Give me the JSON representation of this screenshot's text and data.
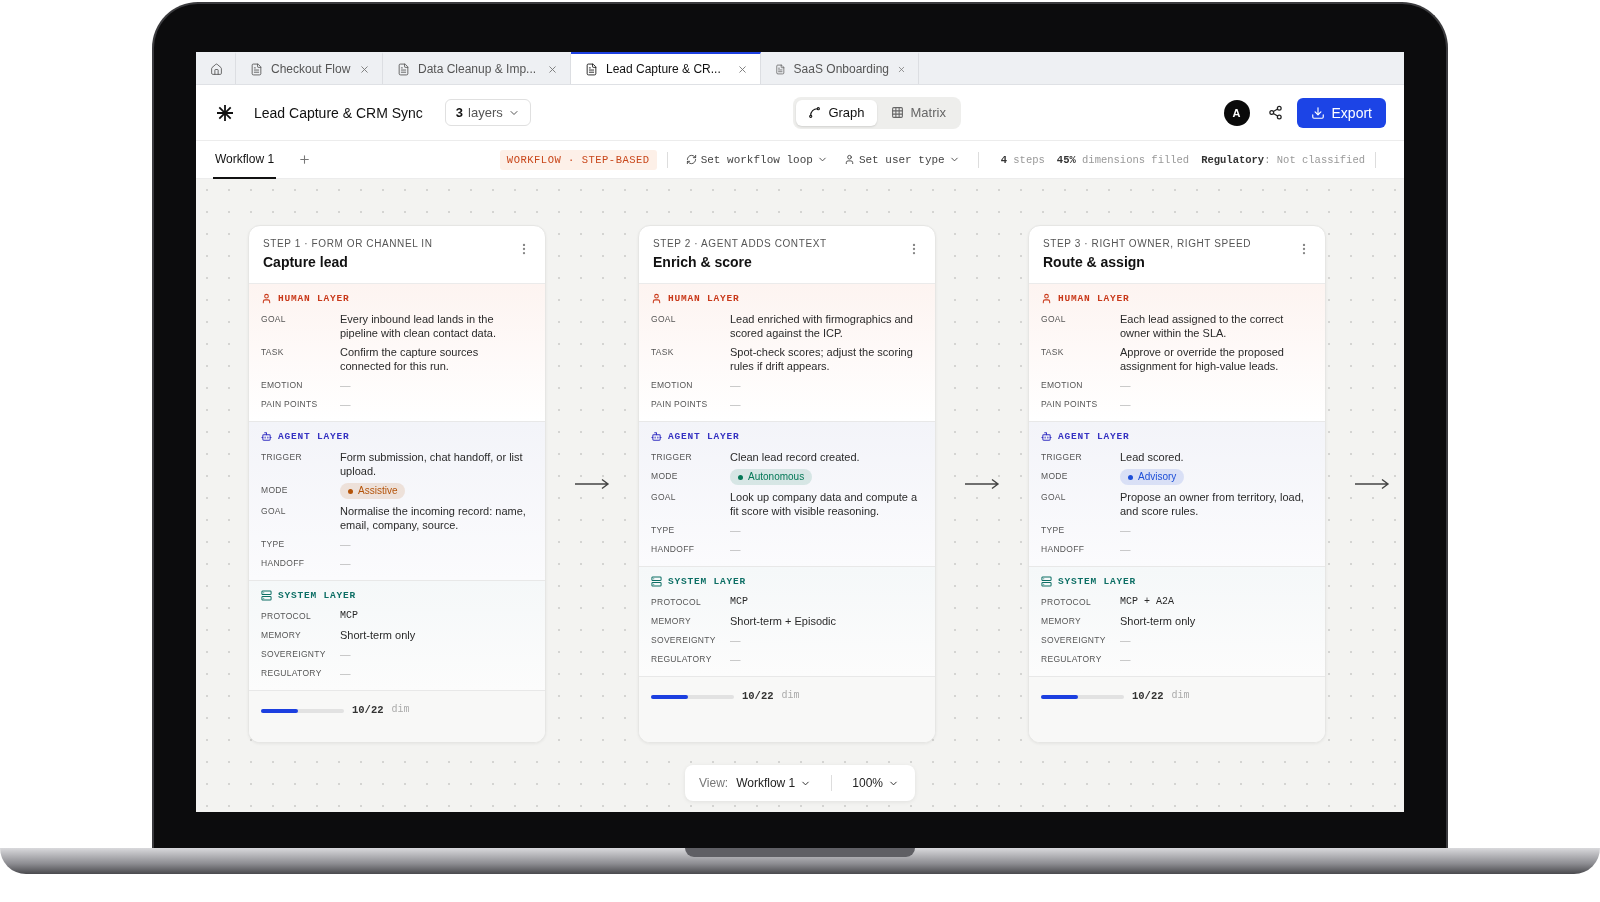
{
  "tabs": [
    {
      "kind": "home",
      "selected": false
    },
    {
      "kind": "document",
      "label": "Checkout Flow",
      "selected": false
    },
    {
      "kind": "document",
      "label": "Data Cleanup & Imp...",
      "selected": false
    },
    {
      "kind": "document",
      "label": "Lead Capture & CR...",
      "selected": true
    },
    {
      "kind": "document",
      "label": "SaaS Onboarding",
      "selected": false
    }
  ],
  "header": {
    "title": "Lead Capture & CRM Sync",
    "layers": {
      "count": "3",
      "label": "layers"
    },
    "views": [
      {
        "kind": "graph",
        "label": "Graph",
        "selected": true
      },
      {
        "kind": "matrix",
        "label": "Matrix",
        "selected": false
      }
    ],
    "avatar": "A",
    "export": "Export"
  },
  "subbar": {
    "workflows": [
      {
        "label": "Workflow 1",
        "selected": true
      }
    ],
    "badge": "WORKFLOW · STEP-BASED",
    "loop": "Set workflow loop",
    "user_type": "Set user type",
    "stats": [
      "**4** steps",
      "**45%** dimensions filled",
      "**Regulatory**: Not classified"
    ]
  },
  "steps": [
    {
      "eyebrow": "STEP 1 · FORM OR CHANNEL IN",
      "title": "Capture lead",
      "layers": [
        {
          "kind": "human",
          "title": "HUMAN LAYER",
          "rows": [
            {
              "label": "GOAL",
              "kind": "text",
              "value": "Every inbound lead lands in the pipeline with clean contact data."
            },
            {
              "label": "TASK",
              "kind": "text",
              "value": "Confirm the capture sources connected for this run."
            },
            {
              "label": "EMOTION",
              "kind": "empty",
              "value": "—"
            },
            {
              "label": "PAIN POINTS",
              "kind": "empty",
              "value": "—"
            }
          ]
        },
        {
          "kind": "agent",
          "title": "AGENT LAYER",
          "rows": [
            {
              "label": "TRIGGER",
              "kind": "text",
              "value": "Form submission, chat handoff, or list upload."
            },
            {
              "label": "MODE",
              "kind": "mode",
              "value": "Assistive",
              "color": "#b45309"
            },
            {
              "label": "GOAL",
              "kind": "text",
              "value": "Normalise the incoming record: name, email, company, source."
            },
            {
              "label": "TYPE",
              "kind": "empty",
              "value": "—"
            },
            {
              "label": "HANDOFF",
              "kind": "empty",
              "value": "—"
            }
          ]
        },
        {
          "kind": "system",
          "title": "SYSTEM LAYER",
          "rows": [
            {
              "label": "PROTOCOL",
              "kind": "mono",
              "value": "MCP"
            },
            {
              "label": "MEMORY",
              "kind": "text",
              "value": "Short-term only"
            },
            {
              "label": "SOVEREIGNTY",
              "kind": "empty",
              "value": "—"
            },
            {
              "label": "REGULATORY",
              "kind": "empty",
              "value": "—"
            }
          ]
        }
      ],
      "progress": {
        "level": 0.45,
        "reading": "10/22",
        "unit": "dim"
      }
    },
    {
      "eyebrow": "STEP 2 · AGENT ADDS CONTEXT",
      "title": "Enrich & score",
      "layers": [
        {
          "kind": "human",
          "title": "HUMAN LAYER",
          "rows": [
            {
              "label": "GOAL",
              "kind": "text",
              "value": "Lead enriched with firmographics and scored against the ICP."
            },
            {
              "label": "TASK",
              "kind": "text",
              "value": "Spot-check scores; adjust the scoring rules if drift appears."
            },
            {
              "label": "EMOTION",
              "kind": "empty",
              "value": "—"
            },
            {
              "label": "PAIN POINTS",
              "kind": "empty",
              "value": "—"
            }
          ]
        },
        {
          "kind": "agent",
          "title": "AGENT LAYER",
          "rows": [
            {
              "label": "TRIGGER",
              "kind": "text",
              "value": "Clean lead record created."
            },
            {
              "label": "MODE",
              "kind": "mode",
              "value": "Autonomous",
              "color": "#047857"
            },
            {
              "label": "GOAL",
              "kind": "text",
              "value": "Look up company data and compute a fit score with visible reasoning."
            },
            {
              "label": "TYPE",
              "kind": "empty",
              "value": "—"
            },
            {
              "label": "HANDOFF",
              "kind": "empty",
              "value": "—"
            }
          ]
        },
        {
          "kind": "system",
          "title": "SYSTEM LAYER",
          "rows": [
            {
              "label": "PROTOCOL",
              "kind": "mono",
              "value": "MCP"
            },
            {
              "label": "MEMORY",
              "kind": "text",
              "value": "Short-term + Episodic"
            },
            {
              "label": "SOVEREIGNTY",
              "kind": "empty",
              "value": "—"
            },
            {
              "label": "REGULATORY",
              "kind": "empty",
              "value": "—"
            }
          ]
        }
      ],
      "progress": {
        "level": 0.45,
        "reading": "10/22",
        "unit": "dim"
      }
    },
    {
      "eyebrow": "STEP 3 · RIGHT OWNER, RIGHT SPEED",
      "title": "Route & assign",
      "layers": [
        {
          "kind": "human",
          "title": "HUMAN LAYER",
          "rows": [
            {
              "label": "GOAL",
              "kind": "text",
              "value": "Each lead assigned to the correct owner within the SLA."
            },
            {
              "label": "TASK",
              "kind": "text",
              "value": "Approve or override the proposed assignment for high-value leads."
            },
            {
              "label": "EMOTION",
              "kind": "empty",
              "value": "—"
            },
            {
              "label": "PAIN POINTS",
              "kind": "empty",
              "value": "—"
            }
          ]
        },
        {
          "kind": "agent",
          "title": "AGENT LAYER",
          "rows": [
            {
              "label": "TRIGGER",
              "kind": "text",
              "value": "Lead scored."
            },
            {
              "label": "MODE",
              "kind": "mode",
              "value": "Advisory",
              "color": "#1d4ed8"
            },
            {
              "label": "GOAL",
              "kind": "text",
              "value": "Propose an owner from territory, load, and score rules."
            },
            {
              "label": "TYPE",
              "kind": "empty",
              "value": "—"
            },
            {
              "label": "HANDOFF",
              "kind": "empty",
              "value": "—"
            }
          ]
        },
        {
          "kind": "system",
          "title": "SYSTEM LAYER",
          "rows": [
            {
              "label": "PROTOCOL",
              "kind": "mono",
              "value": "MCP + A2A"
            },
            {
              "label": "MEMORY",
              "kind": "text",
              "value": "Short-term only"
            },
            {
              "label": "SOVEREIGNTY",
              "kind": "empty",
              "value": "—"
            },
            {
              "label": "REGULATORY",
              "kind": "empty",
              "value": "—"
            }
          ]
        }
      ],
      "progress": {
        "level": 0.45,
        "reading": "10/22",
        "unit": "dim"
      }
    }
  ],
  "view_bar": {
    "label": "View:",
    "workflow": "Workflow 1",
    "zoom": "100%"
  }
}
